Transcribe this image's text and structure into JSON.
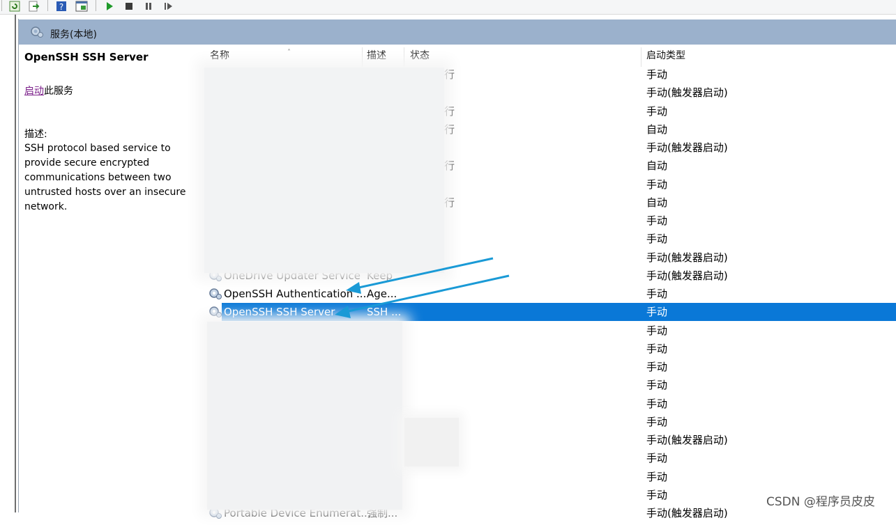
{
  "header": {
    "title": "服务(本地)"
  },
  "detail": {
    "service_name": "OpenSSH SSH Server",
    "start_link": "启动",
    "start_suffix": "此服务",
    "description_label": "描述:",
    "description": "SSH protocol based service to provide secure encrypted communications between two untrusted hosts over an insecure network."
  },
  "columns": {
    "name": "名称",
    "desc": "描述",
    "status": "状态",
    "startup": "启动类型"
  },
  "rows": [
    {
      "name": "",
      "desc": "",
      "status": "行",
      "startup": "手动"
    },
    {
      "name": "",
      "desc": "",
      "status": "",
      "startup": "手动(触发器启动)"
    },
    {
      "name": "",
      "desc": "",
      "status": "行",
      "startup": "手动"
    },
    {
      "name": "",
      "desc": "",
      "status": "行",
      "startup": "自动"
    },
    {
      "name": "",
      "desc": "",
      "status": "",
      "startup": "手动(触发器启动)"
    },
    {
      "name": "",
      "desc": "",
      "status": "行",
      "startup": "自动"
    },
    {
      "name": "",
      "desc": "",
      "status": "",
      "startup": "手动"
    },
    {
      "name": "",
      "desc": "",
      "status": "行",
      "startup": "自动"
    },
    {
      "name": "",
      "desc": "",
      "status": "",
      "startup": "手动"
    },
    {
      "name": "",
      "desc": "",
      "status": "",
      "startup": "手动"
    },
    {
      "name": "",
      "desc": "",
      "status": "",
      "startup": "手动(触发器启动)"
    },
    {
      "name": "OneDrive Updater Service",
      "desc": "Keep",
      "status": "",
      "startup": "手动(触发器启动)"
    },
    {
      "name": "OpenSSH Authentication ...",
      "desc": "Age...",
      "status": "",
      "startup": "手动"
    },
    {
      "name": "OpenSSH SSH Server",
      "desc": "SSH ...",
      "status": "",
      "startup": "手动",
      "selected": true
    },
    {
      "name": "",
      "desc": "",
      "status": "",
      "startup": "手动"
    },
    {
      "name": "",
      "desc": "",
      "status": "",
      "startup": "手动"
    },
    {
      "name": "",
      "desc": "",
      "status": "",
      "startup": "手动"
    },
    {
      "name": "",
      "desc": "",
      "status": "",
      "startup": "手动"
    },
    {
      "name": "",
      "desc": "",
      "status": "",
      "startup": "手动"
    },
    {
      "name": "",
      "desc": "",
      "status": "",
      "startup": "手动"
    },
    {
      "name": "",
      "desc": "",
      "status": "",
      "startup": "手动(触发器启动)"
    },
    {
      "name": "",
      "desc": "",
      "status": "",
      "startup": "手动"
    },
    {
      "name": "",
      "desc": "",
      "status": "",
      "startup": "手动"
    },
    {
      "name": "",
      "desc": "",
      "status": "",
      "startup": "手动"
    },
    {
      "name": "Portable Device Enumerat...",
      "desc": "强制...",
      "status": "",
      "startup": "手动(触发器启动)"
    }
  ],
  "watermark": "CSDN @程序员皮皮",
  "colors": {
    "selection": "#0a78d7",
    "band": "#9bb1cc",
    "link": "#7b1f8a",
    "arrow": "#1a9ad6"
  }
}
